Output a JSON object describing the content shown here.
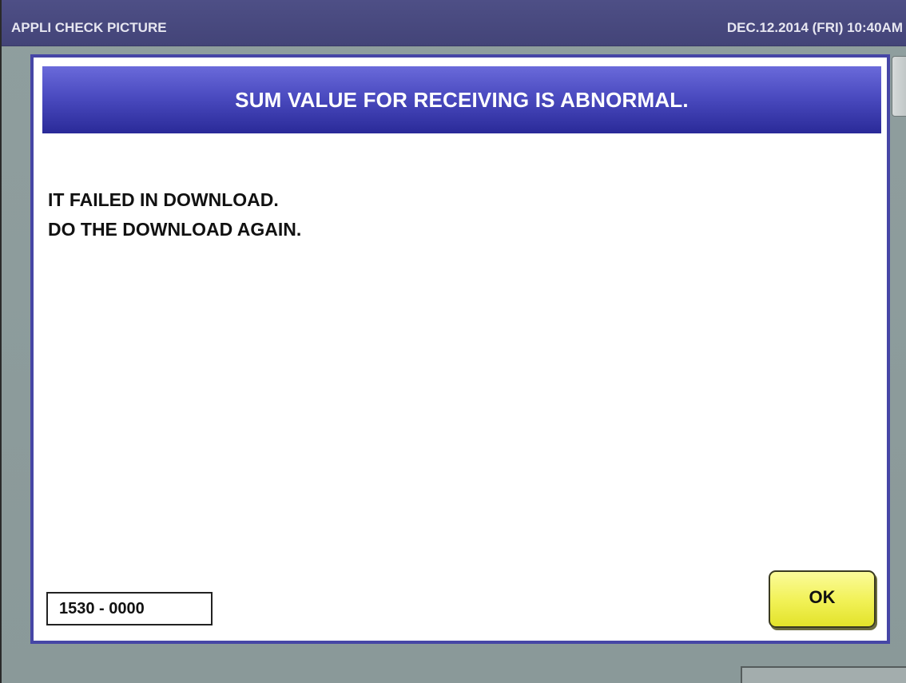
{
  "title_bar": {
    "title": "APPLI CHECK PICTURE",
    "datetime": "DEC.12.2014 (FRI)  10:40AM"
  },
  "dialog": {
    "header": "SUM VALUE FOR RECEIVING IS ABNORMAL.",
    "message_lines": [
      "IT FAILED IN DOWNLOAD.",
      "DO THE DOWNLOAD AGAIN."
    ],
    "error_code": "1530 - 0000",
    "ok_label": "OK"
  },
  "colors": {
    "title_bar": "#48497e",
    "dialog_header": "#4b4bc0",
    "dialog_border": "#4646a6",
    "ok_button": "#f2f25a",
    "background": "#8d9c9c"
  }
}
